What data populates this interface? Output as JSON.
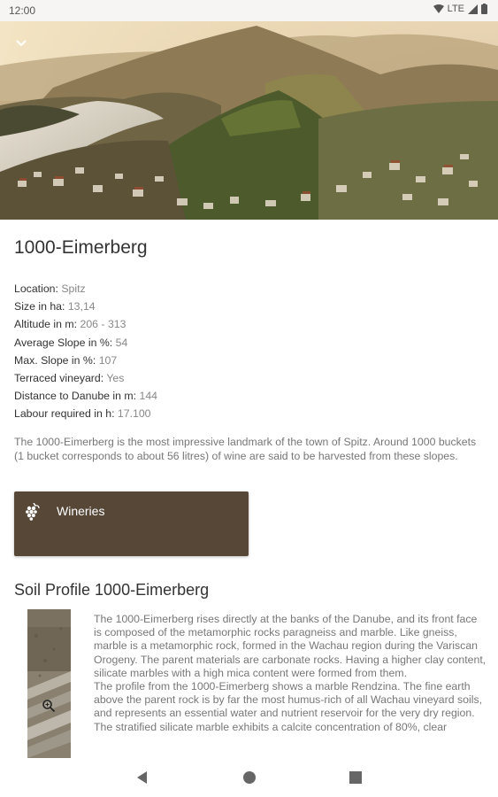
{
  "status_bar": {
    "time": "12:00",
    "network": "LTE"
  },
  "vineyard": {
    "title": "1000-Eimerberg",
    "facts": [
      {
        "label": "Location: ",
        "value": "Spitz"
      },
      {
        "label": "Size in ha: ",
        "value": "13,14"
      },
      {
        "label": "Altitude in m: ",
        "value": "206 - 313"
      },
      {
        "label": "Average Slope in %: ",
        "value": "54"
      },
      {
        "label": "Max. Slope in %: ",
        "value": "107"
      },
      {
        "label": "Terraced vineyard: ",
        "value": "Yes"
      },
      {
        "label": "Distance to Danube in m: ",
        "value": "144"
      },
      {
        "label": "Labour required in h: ",
        "value": "17.100"
      }
    ],
    "description": "The 1000-Eimerberg is the most impressive landmark of the town of Spitz. Around 1000 buckets (1 bucket corresponds to about 56 litres) of wine are said to be harvested from these slopes."
  },
  "wineries_button": {
    "label": "Wineries",
    "color": "#564737"
  },
  "soil": {
    "heading": "Soil Profile 1000-Eimerberg",
    "paragraphs": [
      "The 1000-Eimerberg rises directly at the banks of the Danube, and its front face is composed of the metamorphic rocks paragneiss and marble. Like gneiss, marble is a metamorphic rock, formed in the Wachau region during the Variscan Orogeny. The parent materials are carbonate rocks. Having a higher clay content, silicate marbles with a high mica content were formed from them.",
      "The profile from the 1000-Eimerberg shows a marble Rendzina. The fine earth above the parent rock is by far the most humus-rich of all Wachau vineyard soils, and represents an essential water and nutrient reservoir for the very dry region.",
      "The stratified silicate marble exhibits a calcite concentration of 80%, clear"
    ]
  },
  "icons": {
    "back": "chevron-down-icon",
    "wineries": "grapes-icon",
    "zoom": "magnifier-icon",
    "nav": [
      "back-triangle-icon",
      "home-circle-icon",
      "recents-square-icon"
    ]
  }
}
